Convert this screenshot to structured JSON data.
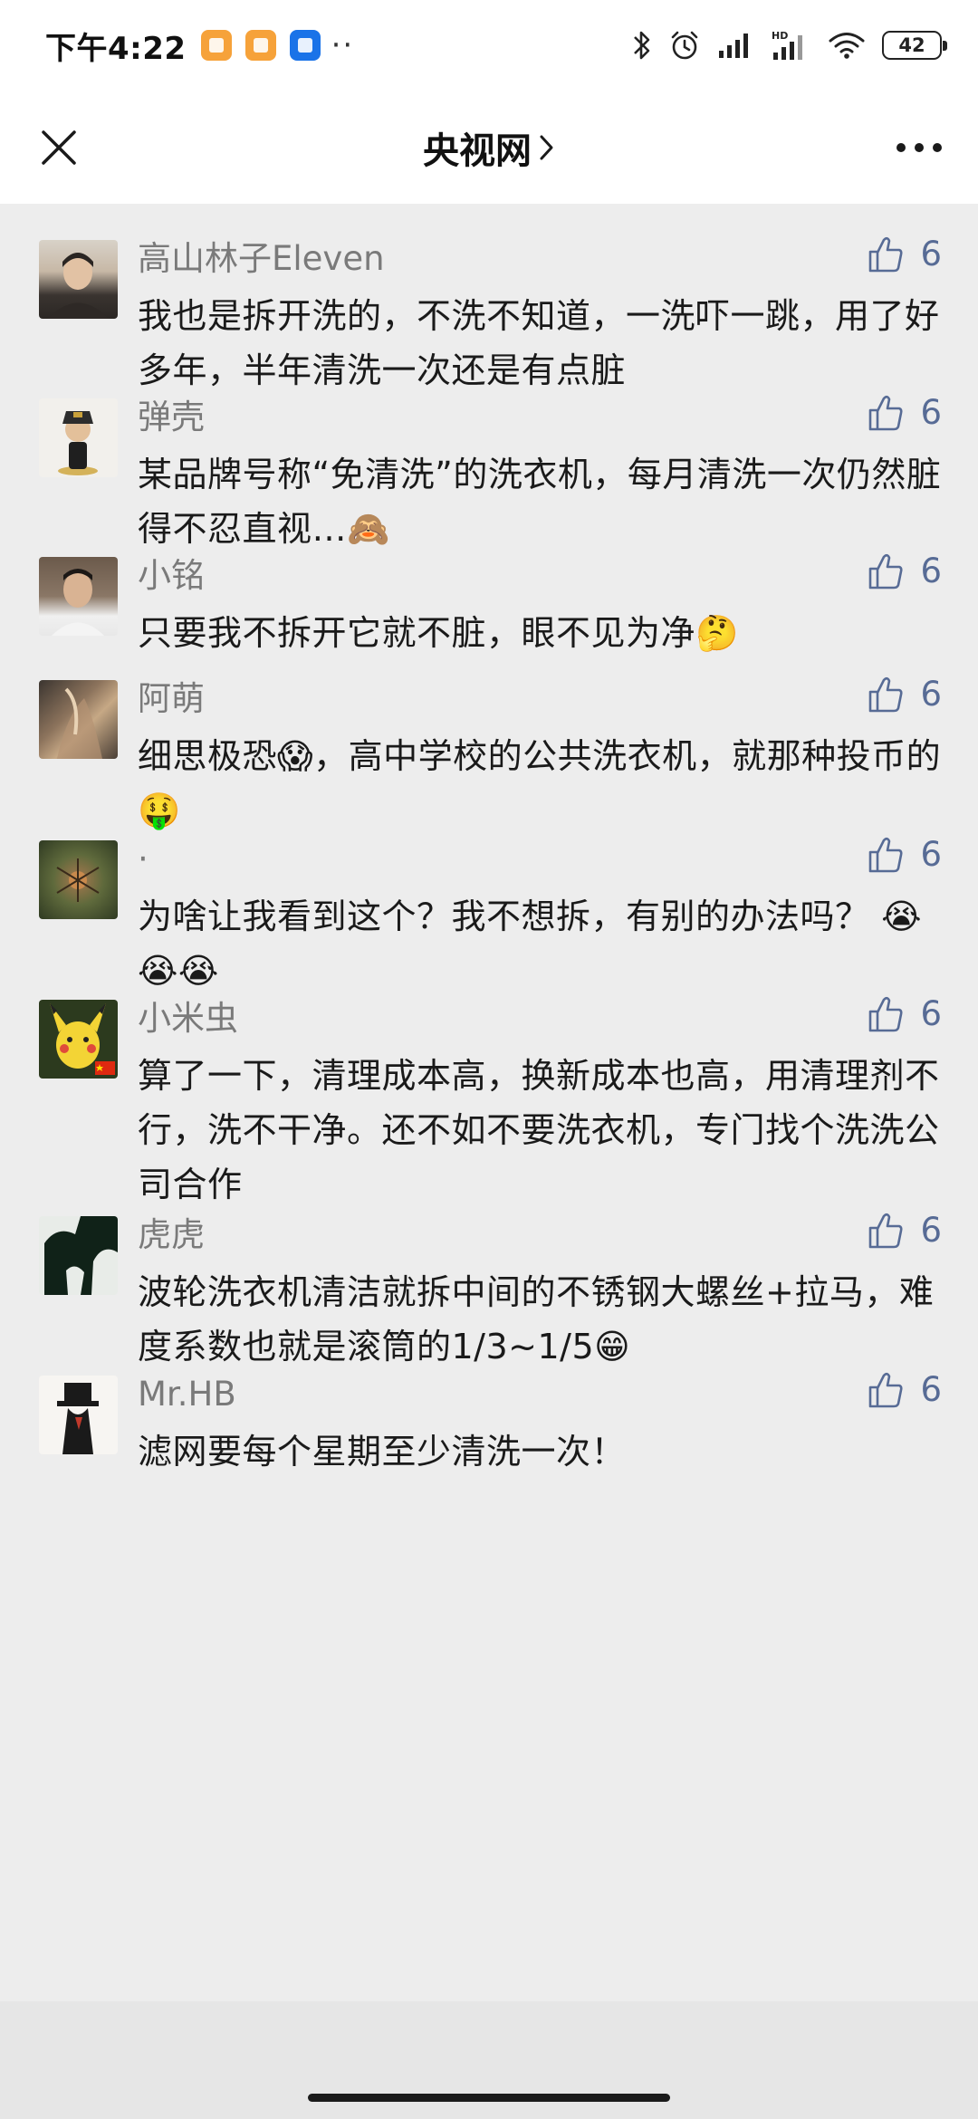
{
  "status_bar": {
    "time": "下午4:22",
    "battery": "42"
  },
  "nav": {
    "title": "央视网",
    "title_chevron": "›"
  },
  "comments": [
    {
      "username": "高山林子Eleven",
      "likes": "6",
      "text": "我也是拆开洗的，不洗不知道，一洗吓一跳，用了好多年，半年清洗一次还是有点脏",
      "emoji": ""
    },
    {
      "username": "弹壳",
      "likes": "6",
      "text": "某品牌号称“免清洗”的洗衣机，每月清洗一次仍然脏得不忍直视…",
      "emoji": "🙈"
    },
    {
      "username": "小铭",
      "likes": "6",
      "text": "只要我不拆开它就不脏，眼不见为净",
      "emoji": "🤔"
    },
    {
      "username": "阿萌",
      "likes": "6",
      "text_a": "细思极恐",
      "emoji_a": "😱",
      "text_b": "，高中学校的公共洗衣机，就那种投币的",
      "emoji_b": "🤑"
    },
    {
      "username": "·",
      "likes": "6",
      "text": "为啥让我看到这个？我不想拆，有别的办法吗？",
      "emoji": "😭😭😭"
    },
    {
      "username": "小米虫",
      "likes": "6",
      "text": "算了一下，清理成本高，换新成本也高，用清理剂不行，洗不干净。还不如不要洗衣机，专门找个洗洗公司合作",
      "emoji": ""
    },
    {
      "username": "虎虎",
      "likes": "6",
      "text": "波轮洗衣机清洁就拆中间的不锈钢大螺丝+拉马，难度系数也就是滚筒的1/3~1/5",
      "emoji": "😁"
    },
    {
      "username": "Mr.HB",
      "likes": "6",
      "text": "滤网要每个星期至少清洗一次！",
      "emoji": ""
    }
  ],
  "colors": {
    "like_blue": "#576b95",
    "username_gray": "#7a7a7a",
    "background": "#ededed"
  }
}
